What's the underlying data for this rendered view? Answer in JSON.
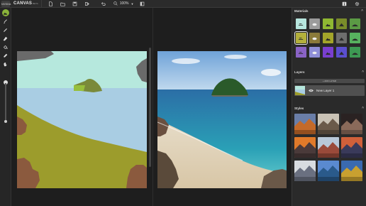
{
  "app": {
    "name": "CANVAS",
    "badge": "BETA",
    "logo_text": "NVIDIA"
  },
  "toolbar": {
    "zoom_value": "100%"
  },
  "panels": {
    "materials_title": "Materials",
    "layers_title": "Layers",
    "styles_title": "Styles",
    "add_layer_label": "+ ADD LAYER",
    "layer_name": "New Layer 1"
  },
  "materials": [
    {
      "name": "sky",
      "color": "#b7e6de",
      "icon": "cloud-sky-icon"
    },
    {
      "name": "cloud",
      "color": "#9b9b9b",
      "icon": "cloud-icon"
    },
    {
      "name": "grass",
      "color": "#8fb832",
      "icon": "grass-icon"
    },
    {
      "name": "mountain",
      "color": "#7a8c2a",
      "icon": "mountain-icon"
    },
    {
      "name": "hill",
      "color": "#5b9a45",
      "icon": "hill-icon"
    },
    {
      "name": "sand",
      "color": "#b3b03c",
      "icon": "sand-icon"
    },
    {
      "name": "dirt",
      "color": "#8a7a3a",
      "icon": "dirt-icon"
    },
    {
      "name": "rock",
      "color": "#a3a52a",
      "icon": "rock-icon"
    },
    {
      "name": "stone",
      "color": "#6e6e6e",
      "icon": "stone-icon"
    },
    {
      "name": "snow",
      "color": "#57b25f",
      "icon": "snow-icon"
    },
    {
      "name": "water",
      "color": "#8a63c6",
      "icon": "water-icon"
    },
    {
      "name": "river",
      "color": "#8f8fd8",
      "icon": "river-icon"
    },
    {
      "name": "sea",
      "color": "#7a3fd0",
      "icon": "sea-icon"
    },
    {
      "name": "fog",
      "color": "#5b4fd0",
      "icon": "fog-icon"
    },
    {
      "name": "tree",
      "color": "#3d9a53",
      "icon": "tree-icon"
    }
  ],
  "selected_material_index": 5,
  "styles": [
    {
      "name": "sunset-clouds",
      "sky": "#6a7ea8",
      "ground": "#c46a2a"
    },
    {
      "name": "white-cliffs",
      "sky": "#c9c2b5",
      "ground": "#6a5a4a"
    },
    {
      "name": "cave-arch",
      "sky": "#2a2222",
      "ground": "#8a6a5a"
    },
    {
      "name": "orange-dusk",
      "sky": "#e07a2a",
      "ground": "#4a3a3a"
    },
    {
      "name": "red-rocks",
      "sky": "#b8c8d8",
      "ground": "#9a4a3a"
    },
    {
      "name": "sea-sunset",
      "sky": "#d0603a",
      "ground": "#3a3a5a"
    },
    {
      "name": "misty-peaks",
      "sky": "#d8dce0",
      "ground": "#6a7080"
    },
    {
      "name": "blue-lake",
      "sky": "#5a8ad0",
      "ground": "#2a5a8a"
    },
    {
      "name": "autumn-lake",
      "sky": "#3a6ab0",
      "ground": "#c8a030"
    }
  ],
  "segmentation_colors": {
    "sky": "#b6e8dd",
    "sea": "#a9cde3",
    "sand": "#9c9c2c",
    "rock": "#8b5a3e",
    "cloud": "#6a6a6a",
    "grass": "#97bf3c",
    "island": "#7a8a3a"
  }
}
